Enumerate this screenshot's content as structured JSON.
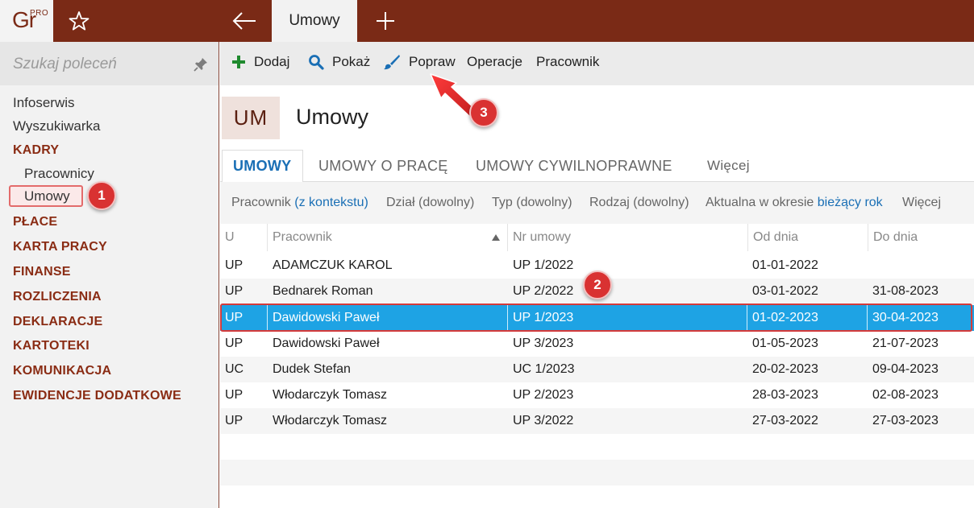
{
  "app": {
    "logo_text": "Gr",
    "logo_badge": "PRO",
    "active_tab": "Umowy"
  },
  "sidebar": {
    "search_placeholder": "Szukaj poleceń",
    "items": [
      {
        "label": "Infoserwis",
        "kind": "item"
      },
      {
        "label": "Wyszukiwarka",
        "kind": "item"
      },
      {
        "label": "KADRY",
        "kind": "section"
      },
      {
        "label": "Pracownicy",
        "kind": "sub"
      },
      {
        "label": "Umowy",
        "kind": "sub",
        "selected": true
      },
      {
        "label": "PŁACE",
        "kind": "section"
      },
      {
        "label": "KARTA PRACY",
        "kind": "section"
      },
      {
        "label": "FINANSE",
        "kind": "section"
      },
      {
        "label": "ROZLICZENIA",
        "kind": "section"
      },
      {
        "label": "DEKLARACJE",
        "kind": "section"
      },
      {
        "label": "KARTOTEKI",
        "kind": "section"
      },
      {
        "label": "KOMUNIKACJA",
        "kind": "section"
      },
      {
        "label": "EWIDENCJE DODATKOWE",
        "kind": "section"
      }
    ]
  },
  "toolbar": {
    "add": "Dodaj",
    "show": "Pokaż",
    "edit": "Popraw",
    "operations": "Operacje",
    "employee": "Pracownik"
  },
  "header": {
    "badge": "UM",
    "title": "Umowy"
  },
  "tabs": [
    "UMOWY",
    "UMOWY O PRACĘ",
    "UMOWY CYWILNOPRAWNE",
    "Więcej"
  ],
  "filters": {
    "employee_label": "Pracownik",
    "employee_value": "(z kontekstu)",
    "department": "Dział (dowolny)",
    "type": "Typ (dowolny)",
    "kind": "Rodzaj (dowolny)",
    "period_label": "Aktualna w okresie",
    "period_value": "bieżący rok",
    "more": "Więcej"
  },
  "table": {
    "columns": [
      "U",
      "Pracownik",
      "Nr umowy",
      "Od dnia",
      "Do dnia"
    ],
    "rows": [
      [
        "UP",
        "ADAMCZUK KAROL",
        "UP 1/2022",
        "01-01-2022",
        ""
      ],
      [
        "UP",
        "Bednarek Roman",
        "UP 2/2022",
        "03-01-2022",
        "31-08-2023"
      ],
      [
        "UP",
        "Dawidowski Paweł",
        "UP 1/2023",
        "01-02-2023",
        "30-04-2023"
      ],
      [
        "UP",
        "Dawidowski Paweł",
        "UP 3/2023",
        "01-05-2023",
        "21-07-2023"
      ],
      [
        "UC",
        "Dudek Stefan",
        "UC 1/2023",
        "20-02-2023",
        "09-04-2023"
      ],
      [
        "UP",
        "Włodarczyk Tomasz",
        "UP 2/2023",
        "28-03-2023",
        "02-08-2023"
      ],
      [
        "UP",
        "Włodarczyk Tomasz",
        "UP 3/2022",
        "27-03-2022",
        "27-03-2023"
      ]
    ],
    "selected_row": 2
  },
  "annotations": [
    "1",
    "2",
    "3"
  ],
  "colors": {
    "brand": "#7a2a16",
    "accent": "#1a6fb5",
    "selection": "#1ea3e4",
    "marker": "#d93232"
  },
  "icons": {
    "star": "star-icon",
    "back": "arrow-left-icon",
    "new_tab": "plus-icon",
    "pin": "pin-icon",
    "add": "plus-icon",
    "show": "magnifier-icon",
    "edit": "brush-icon",
    "sort": "sort-up-icon"
  }
}
